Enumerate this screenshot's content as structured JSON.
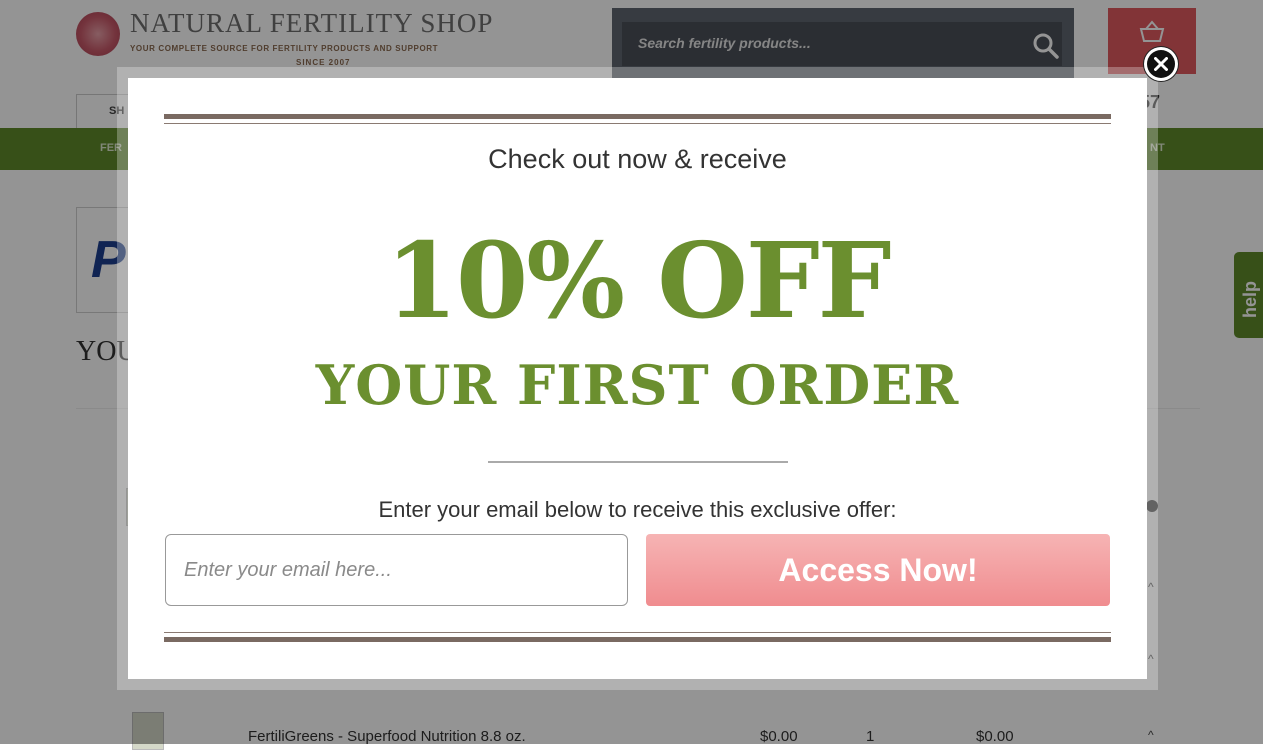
{
  "site": {
    "logo_title": "NATURAL FERTILITY SHOP",
    "logo_tagline": "YOUR COMPLETE SOURCE FOR FERTILITY PRODUCTS AND SUPPORT",
    "logo_since": "SINCE 2007",
    "search_placeholder": "Search fertility products...",
    "shop_tab_label": "SH",
    "phone_snippet": "57",
    "nav_left_label": "FER",
    "nav_right_label": "NT",
    "paypal_mark": "P",
    "cart_heading": "YOU",
    "help_label": "help"
  },
  "background_row": {
    "product_name": "FertiliGreens - Superfood Nutrition 8.8 oz.",
    "price": "$0.00",
    "quantity": "1",
    "total": "$0.00",
    "caret": "^"
  },
  "popup": {
    "close_label": "×",
    "headline": "Check out now & receive",
    "offer": "10% OFF",
    "offer_subline": "YOUR FIRST ORDER",
    "instruction": "Enter your email below to receive this exclusive offer:",
    "email_placeholder": "Enter your email here...",
    "email_value": "",
    "cta_label": "Access Now!"
  },
  "colors": {
    "accent_green": "#6b8f2f",
    "cta_pink": "#f08c8f",
    "rule_brown": "#7a6a62",
    "nav_green": "#5f8a2a",
    "cart_red": "#e05a5f"
  }
}
